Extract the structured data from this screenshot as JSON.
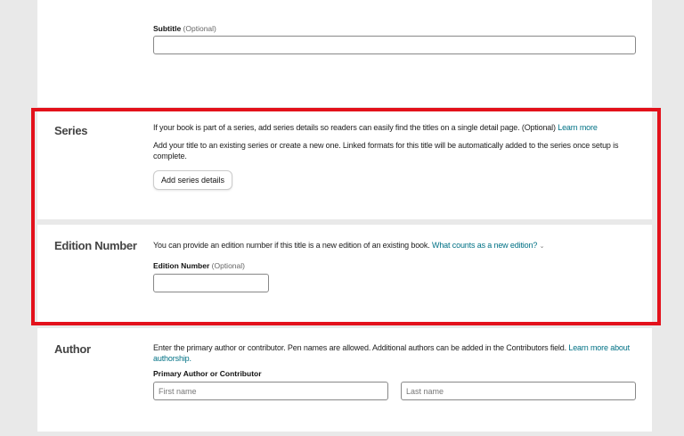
{
  "subtitle": {
    "label": "Subtitle",
    "optional": "(Optional)",
    "value": ""
  },
  "series": {
    "heading": "Series",
    "text1": "If your book is part of a series, add series details so readers can easily find the titles on a single detail page. (Optional)",
    "learn_more": "Learn more",
    "text2": "Add your title to an existing series or create a new one. Linked formats for this title will be automatically added to the series once setup is complete.",
    "button": "Add series details"
  },
  "edition": {
    "heading": "Edition Number",
    "text": "You can provide an edition number if this title is a new edition of an existing book.",
    "link": "What counts as a new edition?",
    "chevron": "⌄",
    "label": "Edition Number",
    "optional": "(Optional)",
    "value": ""
  },
  "author": {
    "heading": "Author",
    "text": "Enter the primary author or contributor. Pen names are allowed. Additional authors can be added in the Contributors field.",
    "link": "Learn more about authorship.",
    "label": "Primary Author or Contributor",
    "first_placeholder": "First name",
    "last_placeholder": "Last name"
  },
  "highlight_color": "#e3111b"
}
